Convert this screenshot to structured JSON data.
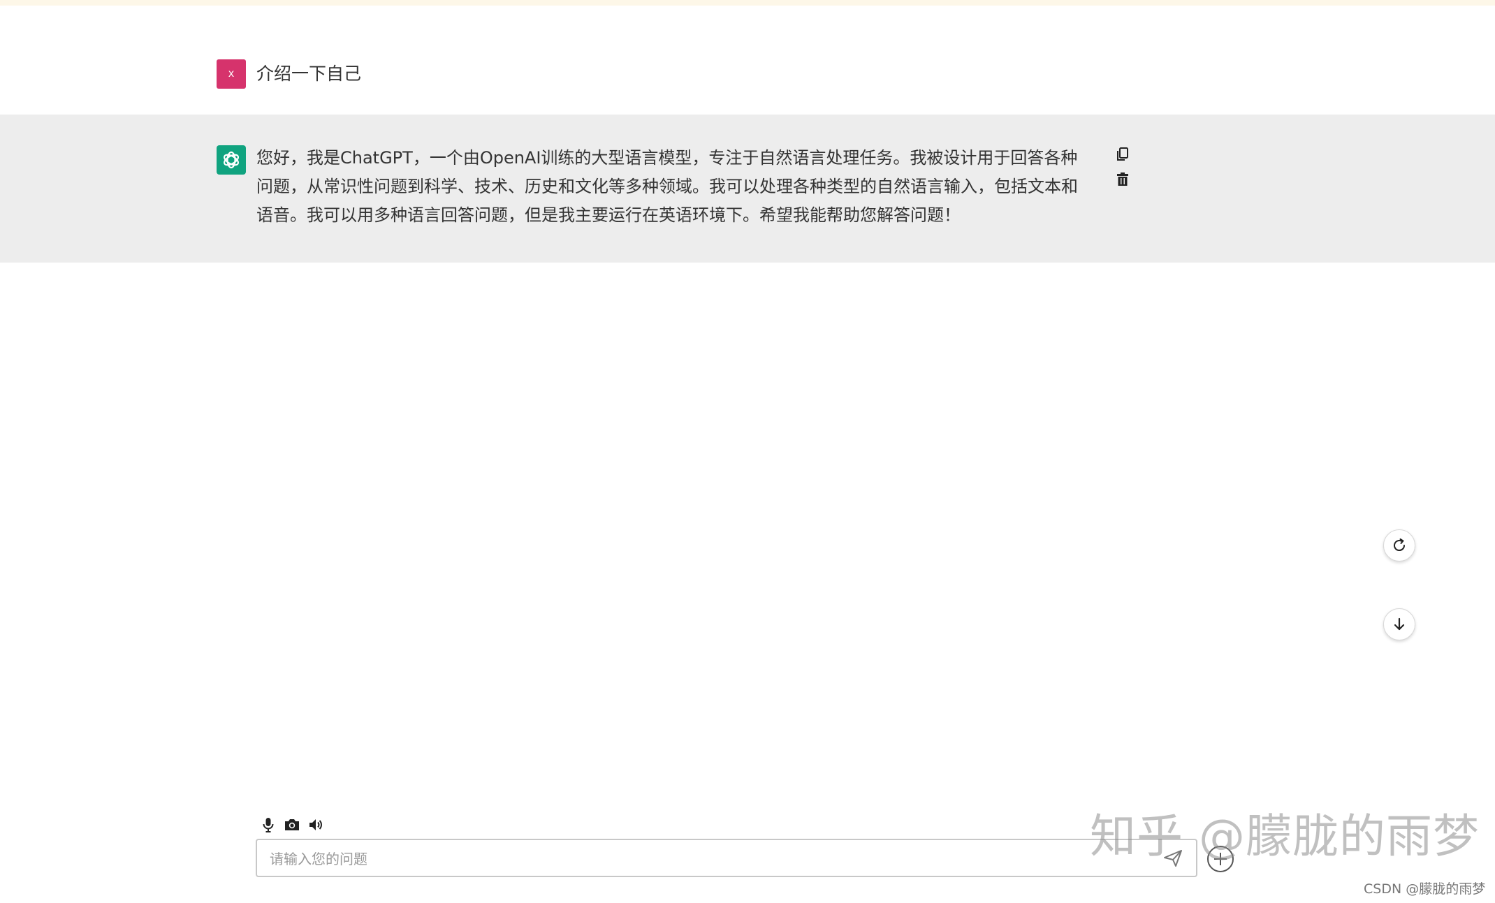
{
  "conversation": {
    "user_message": {
      "avatar_label": "x",
      "text": "介绍一下自己"
    },
    "assistant_message": {
      "text": "您好，我是ChatGPT，一个由OpenAI训练的大型语言模型，专注于自然语言处理任务。我被设计用于回答各种问题，从常识性问题到科学、技术、历史和文化等多种领域。我可以处理各种类型的自然语言输入，包括文本和语音。我可以用多种语言回答问题，但是我主要运行在英语环境下。希望我能帮助您解答问题！",
      "actions": [
        "copy-icon",
        "delete-icon"
      ]
    }
  },
  "floating_controls": {
    "regenerate_icon": "refresh-icon",
    "scroll_down_icon": "arrow-down-icon"
  },
  "input_area": {
    "tools": [
      "microphone-icon",
      "camera-icon",
      "speaker-icon"
    ],
    "placeholder": "请输入您的问题",
    "value": "",
    "send_icon": "send-icon",
    "add_icon": "add-icon"
  },
  "watermark": {
    "zhihu": "知乎 @朦胧的雨梦",
    "csdn": "CSDN @朦胧的雨梦"
  },
  "colors": {
    "user_avatar": "#d6336c",
    "assistant_avatar": "#10a37f",
    "assistant_bg": "#ededed",
    "top_strip": "#fdf7e8"
  }
}
